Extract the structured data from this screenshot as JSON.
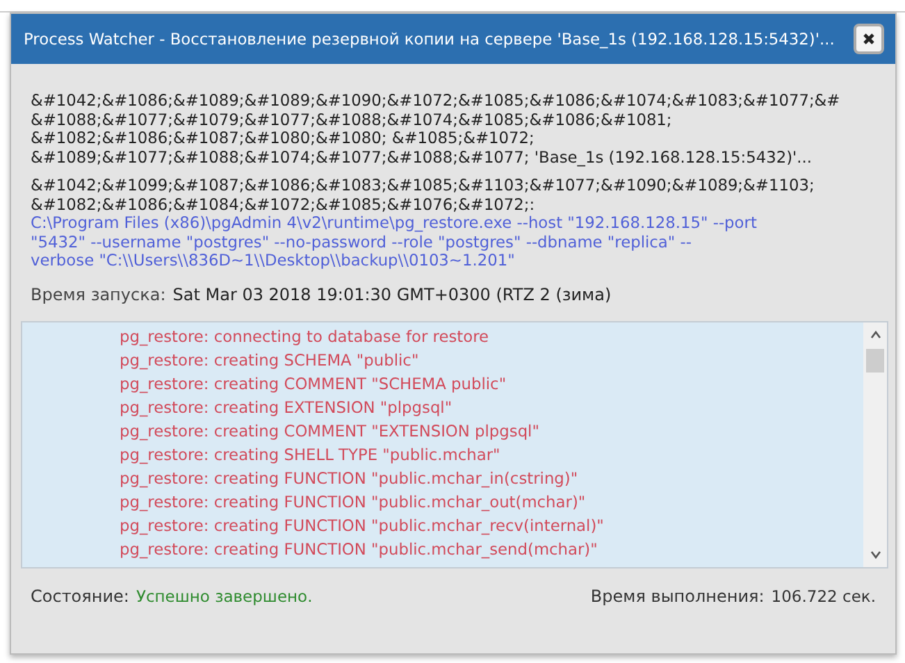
{
  "window": {
    "title": "Process Watcher - Восстановление резервной копии на сервере 'Base_1s (192.168.128.15:5432)'..."
  },
  "description_lines": [
    "&#1042;&#1086;&#1089;&#1089;&#1090;&#1072;&#1085;&#1086;&#1074;&#1083;&#1077;&#",
    "&#1088;&#1077;&#1079;&#1077;&#1088;&#1074;&#1085;&#1086;&#1081;",
    "&#1082;&#1086;&#1087;&#1080;&#1080; &#1085;&#1072;",
    "&#1089;&#1077;&#1088;&#1074;&#1077;&#1088;&#1077; 'Base_1s (192.168.128.15:5432)'..."
  ],
  "command_label_lines": [
    "&#1042;&#1099;&#1087;&#1086;&#1083;&#1085;&#1103;&#1077;&#1090;&#1089;&#1103;",
    "&#1082;&#1086;&#1084;&#1072;&#1085;&#1076;&#1072;:"
  ],
  "command_lines": [
    "C:\\Program Files (x86)\\pgAdmin 4\\v2\\runtime\\pg_restore.exe --host \"192.168.128.15\" --port",
    "\"5432\" --username \"postgres\" --no-password --role \"postgres\" --dbname \"replica\" --",
    "verbose \"C:\\\\Users\\\\836D~1\\\\Desktop\\\\backup\\\\0103~1.201\""
  ],
  "start_time": {
    "label": "Время запуска:",
    "value": "Sat Mar 03 2018 19:01:30 GMT+0300 (RTZ 2 (зима)"
  },
  "log": [
    "pg_restore: connecting to database for restore",
    "pg_restore: creating SCHEMA \"public\"",
    "pg_restore: creating COMMENT \"SCHEMA public\"",
    "pg_restore: creating EXTENSION \"plpgsql\"",
    "pg_restore: creating COMMENT \"EXTENSION plpgsql\"",
    "pg_restore: creating SHELL TYPE \"public.mchar\"",
    "pg_restore: creating FUNCTION \"public.mchar_in(cstring)\"",
    "pg_restore: creating FUNCTION \"public.mchar_out(mchar)\"",
    "pg_restore: creating FUNCTION \"public.mchar_recv(internal)\"",
    "pg_restore: creating FUNCTION \"public.mchar_send(mchar)\""
  ],
  "status": {
    "label": "Состояние:",
    "value": "Успешно завершено.",
    "kind": "success"
  },
  "duration": {
    "label": "Время выполнения:",
    "value": "106.722 сек."
  }
}
